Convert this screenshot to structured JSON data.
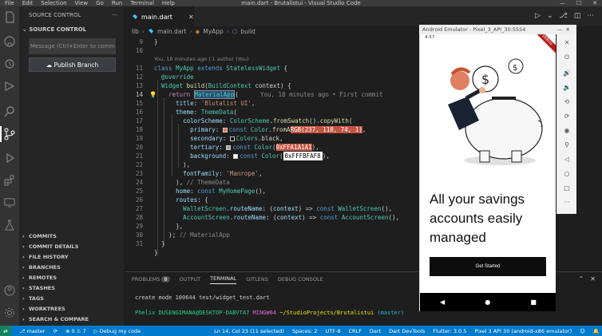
{
  "window": {
    "menu": [
      "File",
      "Edit",
      "Selection",
      "View",
      "Go",
      "Run",
      "Terminal",
      "Help"
    ],
    "title": "main.dart - Brutalistui - Visual Studio Code",
    "controls": [
      "—",
      "☐",
      "✕"
    ]
  },
  "sidebar": {
    "header": "SOURCE CONTROL",
    "section_title": "SOURCE CONTROL",
    "commit_placeholder": "Message (Ctrl+Enter to comm...",
    "publish_label": "Publish Branch",
    "sections": [
      "COMMITS",
      "COMMIT DETAILS",
      "FILE HISTORY",
      "BRANCHES",
      "REMOTES",
      "STASHES",
      "TAGS",
      "WORKTREES",
      "SEARCH & COMPARE"
    ]
  },
  "tab": {
    "label": "main.dart"
  },
  "breadcrumb": [
    "lib",
    "main.dart",
    "MyApp",
    "build"
  ],
  "editor": {
    "blame_header": "You, 18 minutes ago | 1 author (You)",
    "inline_blame": "You, 18 minutes ago • First commit",
    "line_numbers": [
      "9",
      "10",
      "11",
      "12",
      "13",
      "14",
      "15",
      "16",
      "17",
      "18",
      "19",
      "20",
      "21",
      "22",
      "23",
      "24",
      "25",
      "26",
      "27",
      "28",
      "29",
      "30",
      "31"
    ],
    "current_line": "14",
    "code": {
      "l9": "}",
      "l11_a": "class ",
      "l11_b": "MyApp ",
      "l11_c": "extends ",
      "l11_d": "StatelessWidget",
      "l11_e": " {",
      "l12": "@override",
      "l13_a": "Widget ",
      "l13_b": "build",
      "l13_c": "(",
      "l13_d": "BuildContext",
      "l13_e": " context) {",
      "l14_a": "return ",
      "l14_b": "MaterialApp",
      "l14_c": "(",
      "l15_a": "title",
      "l15_b": ": ",
      "l15_c": "'Blutalist UI'",
      "l15_d": ",",
      "l16_a": "theme",
      "l16_b": ": ",
      "l16_c": "ThemeData",
      "l16_d": "(",
      "l17_a": "colorScheme",
      "l17_b": ": ",
      "l17_c": "ColorScheme",
      "l17_d": ".",
      "l17_e": "fromSwatch",
      "l17_f": "().",
      "l17_g": "copyWith",
      "l17_h": "(",
      "l18_a": "primary",
      "l18_b": ": ",
      "l18_c": "const ",
      "l18_d": "Color",
      "l18_e": ".",
      "l18_f": "fromA",
      "l18_g": "RGB(237, 118, 74, 1)",
      "l18_h": ",",
      "l19_a": "secondary",
      "l19_b": ": ",
      "l19_c": "Colors",
      "l19_d": ".black,",
      "l20_a": "tertiary",
      "l20_b": ": ",
      "l20_c": "const ",
      "l20_d": "Color",
      "l20_e": "(",
      "l20_f": "0xFFA1A1A1",
      "l20_g": "),",
      "l21_a": "background",
      "l21_b": ": ",
      "l21_c": "const ",
      "l21_d": "Color",
      "l21_e": "(",
      "l21_f": "0xFFFBFAF8",
      "l21_g": "),",
      "l22": "),",
      "l23_a": "fontFamily",
      "l23_b": ": ",
      "l23_c": "'Manrope'",
      "l23_d": ",",
      "l24_a": "), ",
      "l24_b": "// ThemeData",
      "l25_a": "home",
      "l25_b": ": ",
      "l25_c": "const ",
      "l25_d": "MyHomePage",
      "l25_e": "(),",
      "l26_a": "routes",
      "l26_b": ": {",
      "l27_a": "WalletScreen",
      "l27_b": ".",
      "l27_c": "routeName",
      "l27_d": ": (",
      "l27_e": "context",
      "l27_f": ") => ",
      "l27_g": "const ",
      "l27_h": "WalletScreen",
      "l27_i": "(),",
      "l28_a": "AccountScreen",
      "l28_b": ".",
      "l28_c": "routeName",
      "l28_d": ": (",
      "l28_e": "context",
      "l28_f": ") => ",
      "l28_g": "const ",
      "l28_h": "AccountScreen",
      "l28_i": "(),",
      "l29": "},",
      "l30_a": "); ",
      "l30_b": "// MaterialApp",
      "l31": "}",
      "l32": "}"
    }
  },
  "panel": {
    "tabs": [
      "PROBLEMS",
      "OUTPUT",
      "TERMINAL",
      "GITLENS",
      "DEBUG CONSOLE"
    ],
    "problems_count": "8",
    "active_tab": "TERMINAL",
    "terminal": {
      "line1": "create mode 100644 test/widget_test.dart",
      "user": "Phelix DUSENGIMANA@DESKTOP-DABVTA7",
      "shell": "MINGW64",
      "path": "~/StudioProjects/Brutalistui",
      "branch": "(master)"
    }
  },
  "statusbar": {
    "branch": "master",
    "sync": "⟳",
    "errors": "0",
    "warnings": "7",
    "debug": "Debug my code",
    "position": "Ln 14, Col 23 (11 selected)",
    "spaces": "Spaces: 2",
    "encoding": "UTF-8",
    "eol": "CRLF",
    "language": "Dart",
    "devtools": "Dart DevTools",
    "flutter": "Flutter: 3.0.5",
    "device": "Pixel 3 API 30 (android-x86 emulator)"
  },
  "emulator": {
    "title": "Android Emulator - Pixel_3_API_30:5554",
    "time": "4:57",
    "debug_ribbon": "DEBUG",
    "headline": "All your savings accounts easily managed",
    "button_label": "Get Started",
    "dollar": "$"
  },
  "colors": {
    "accent": "#007acc",
    "primary_orange": "#ed764a",
    "status_bg": "#007acc"
  }
}
